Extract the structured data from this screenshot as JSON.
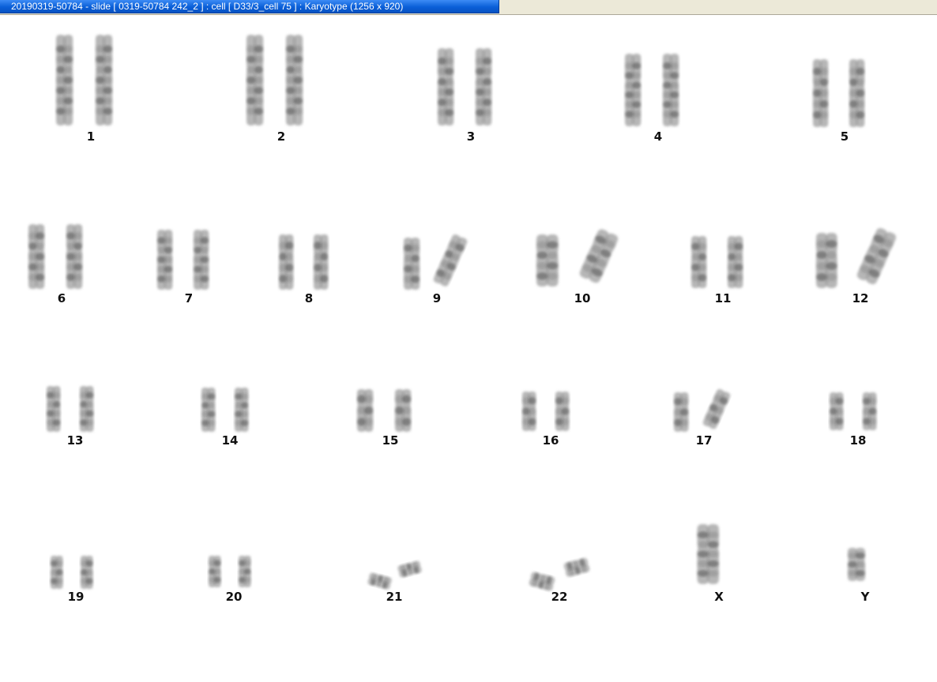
{
  "window": {
    "title": "20190319-50784 - slide [ 0319-50784 242_2 ] : cell [ D33/3_cell 75 ] : Karyotype  (1256 x 920)"
  },
  "colors": {
    "title_bar": "#0a5fd8",
    "chromosome": "#7a7a7a",
    "band": "#3c3c3c",
    "label": "#111111"
  },
  "karyotype": {
    "chromosomes": [
      {
        "label": "1"
      },
      {
        "label": "2"
      },
      {
        "label": "3"
      },
      {
        "label": "4"
      },
      {
        "label": "5"
      },
      {
        "label": "6"
      },
      {
        "label": "7"
      },
      {
        "label": "8"
      },
      {
        "label": "9"
      },
      {
        "label": "10"
      },
      {
        "label": "11"
      },
      {
        "label": "12"
      },
      {
        "label": "13"
      },
      {
        "label": "14"
      },
      {
        "label": "15"
      },
      {
        "label": "16"
      },
      {
        "label": "17"
      },
      {
        "label": "18"
      },
      {
        "label": "19"
      },
      {
        "label": "20"
      },
      {
        "label": "21"
      },
      {
        "label": "22"
      },
      {
        "label": "X"
      },
      {
        "label": "Y"
      }
    ]
  }
}
